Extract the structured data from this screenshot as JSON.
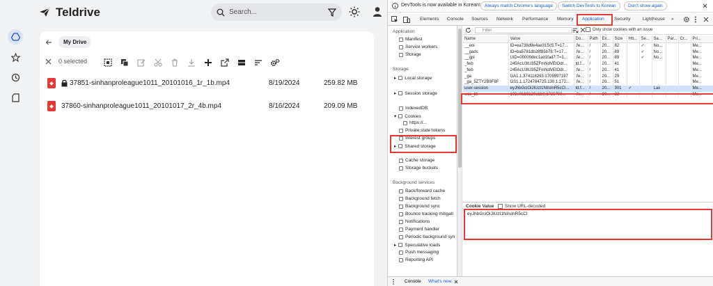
{
  "app": {
    "name": "Teldrive",
    "search_placeholder": "Search...",
    "breadcrumb": "My Drive",
    "selected_label": "0 selected",
    "files": [
      {
        "name": "37851-sinhanproleague1011_20101016_1r_1b.mp4",
        "date": "8/19/2024",
        "size": "259.82 MB",
        "locked": true
      },
      {
        "name": "37860-sinhanproleague1011_20101017_2r_4b.mp4",
        "date": "8/16/2024",
        "size": "209.09 MB",
        "locked": false
      }
    ],
    "accent": "#1a57c6",
    "file_icon_color": "#e53935"
  },
  "devtools": {
    "info_text": "DevTools is now available in Korean!",
    "info_buttons": [
      "Always match Chrome's language",
      "Switch DevTools to Korean",
      "Don't show again"
    ],
    "tabs": [
      "Elements",
      "Console",
      "Sources",
      "Network",
      "Performance",
      "Memory",
      "Application",
      "Security",
      "Lighthouse"
    ],
    "active_tab": "Application",
    "more_tabs": "»",
    "sidebar": {
      "application_header": "Application",
      "application_items": [
        "Manifest",
        "Service workers",
        "Storage"
      ],
      "storage_header": "Storage",
      "storage_items": [
        "Local storage",
        "Session storage",
        "IndexedDB",
        "Cookies",
        "https://...",
        "Private state tokens",
        "Interest groups",
        "Shared storage",
        "Cache storage",
        "Storage buckets"
      ],
      "bg_header": "Background services",
      "bg_items": [
        "Back/forward cache",
        "Background fetch",
        "Background sync",
        "Bounce tracking mitigati",
        "Notifications",
        "Payment handler",
        "Periodic background syn",
        "Speculative loads",
        "Push messaging",
        "Reporting API"
      ]
    },
    "filter_placeholder": "Filter",
    "only_issue_label": "Only show cookies with an issue",
    "columns": [
      "Name",
      "Value",
      "Do...",
      "Path",
      "Ex...",
      "Size",
      "Htt...",
      "Se...",
      "Sa...",
      "Par...",
      "Cr...",
      "Pri..."
    ],
    "rows": [
      [
        "__eoi",
        "ID=ea738d9e4ae315c5:T=17...",
        ".fe...",
        "/",
        "20...",
        "82",
        "",
        "✓",
        "No...",
        "",
        "",
        "Me..."
      ],
      [
        "__gads",
        "ID=ba5781db28f85b78:T=17...",
        ".fe...",
        "/",
        "20...",
        "89",
        "",
        "✓",
        "No...",
        "",
        "",
        "Me..."
      ],
      [
        "__gpi",
        "UID=00000dec1ad1fad7:T=1...",
        ".fe...",
        "/",
        "20...",
        "89",
        "",
        "✓",
        "No...",
        "",
        "",
        "Me..."
      ],
      [
        "_fwb",
        "245AcU3tU35ZFmNdVEtOdr...",
        "td.f...",
        "/",
        "20...",
        "41",
        "",
        "",
        "",
        "",
        "",
        "Me..."
      ],
      [
        "_fwb",
        "245AcU3tU35ZFmNdVEtOdr...",
        ".fe...",
        "/",
        "20...",
        "41",
        "",
        "",
        "",
        "",
        "",
        "Me..."
      ],
      [
        "_ga",
        "GA1.1.374118293.1709597197",
        ".fe...",
        "/",
        "20...",
        "29",
        "",
        "",
        "",
        "",
        "",
        "Me..."
      ],
      [
        "_ga_5ZTY2B9F8F",
        "GS1.1.1724784725.130.1.172...",
        ".fe...",
        "/",
        "20...",
        "51",
        "",
        "",
        "",
        "",
        "",
        "Me..."
      ],
      [
        "user-session",
        "eyJhbGciOiJIUzI1NiIsInR5cCI...",
        "td.f...",
        "/",
        "20...",
        "301",
        "✓",
        "",
        "Lax",
        "",
        "",
        "Me..."
      ],
      [
        "wcs_bt",
        "103e01b8129ebb0:1725789...",
        ".fe...",
        "/",
        "20...",
        "32",
        "",
        "",
        "",
        "",
        "",
        "Me..."
      ]
    ],
    "selected_row_index": 7,
    "cookie_value_label": "Cookie Value",
    "show_decoded_label": "Show URL-decoded",
    "cookie_value": "eyJhbGciOiJIUzI1NiIsInR5cCI",
    "drawer_tabs": [
      "Console",
      "What's new"
    ],
    "highlight_color": "#e53935"
  }
}
